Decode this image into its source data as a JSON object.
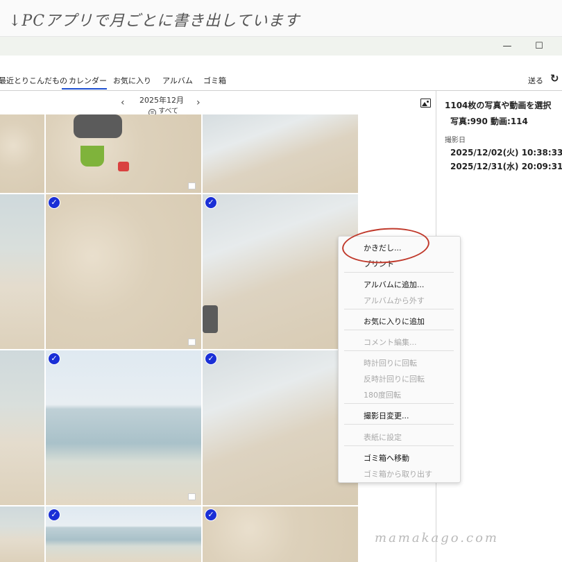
{
  "caption": "↓PCアプリで月ごとに書き出しています",
  "window": {
    "minimize_glyph": "—",
    "maximize_glyph": "☐"
  },
  "nav": {
    "items": [
      "最近とりこんだもの",
      "カレンダー",
      "お気に入り",
      "アルバム",
      "ゴミ箱"
    ],
    "active": "カレンダー",
    "send_label": "送る",
    "refresh_icon": "refresh-icon"
  },
  "month": {
    "label": "2025年12月",
    "filter_label": "すべて",
    "prev_glyph": "‹",
    "next_glyph": "›"
  },
  "selection": {
    "title": "1104枚の写真や動画を選択",
    "counts": "写真:990 動画:114",
    "date_label": "撮影日",
    "date_from": "2025/12/02(火) 10:38:33~",
    "date_to": "2025/12/31(水) 20:09:31"
  },
  "context_menu": {
    "export": "かきだし...",
    "print": "プリント",
    "add_album": "アルバムに追加...",
    "remove_album": "アルバムから外す",
    "add_favorite": "お気に入りに追加",
    "edit_comment": "コメント編集...",
    "rotate_cw": "時計回りに回転",
    "rotate_ccw": "反時計回りに回転",
    "rotate_180": "180度回転",
    "change_date": "撮影日変更...",
    "set_cover": "表紙に設定",
    "move_trash": "ゴミ箱へ移動",
    "restore_trash": "ゴミ箱から取り出す"
  },
  "watermark": "mamakago.com",
  "colors": {
    "accent": "#1d4fd1",
    "check": "#1a2fd6",
    "highlight_circle": "#c0392b"
  }
}
